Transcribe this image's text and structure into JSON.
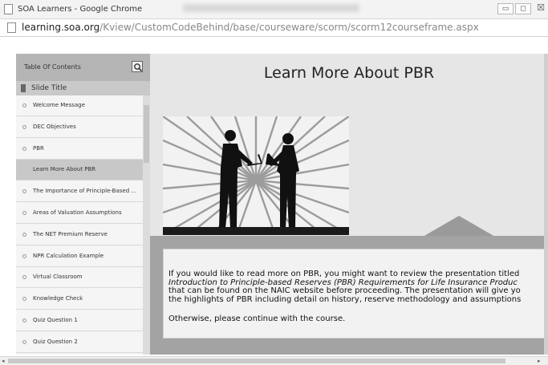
{
  "window": {
    "title": "SOA Learners - Google Chrome",
    "controls": {
      "minimize": "▭",
      "maximize": "◻",
      "close": "☒"
    }
  },
  "address": {
    "host": "learning.soa.org",
    "path": "/Kview/CustomCodeBehind/base/courseware/scorm/scorm12courseframe.aspx"
  },
  "toc": {
    "title": "Table Of Contents",
    "column_header": "Slide Title",
    "items": [
      {
        "label": "Welcome Message",
        "active": false
      },
      {
        "label": "DEC Objectives",
        "active": false
      },
      {
        "label": "PBR",
        "active": false
      },
      {
        "label": "Learn More About PBR",
        "active": true
      },
      {
        "label": "The Importance of Principle-Based ...",
        "active": false
      },
      {
        "label": "Areas of Valuation Assumptions",
        "active": false
      },
      {
        "label": "The NET Premium Reserve",
        "active": false
      },
      {
        "label": "NPR Calculation Example",
        "active": false
      },
      {
        "label": "Virtual Classroom",
        "active": false
      },
      {
        "label": "Knowledge Check",
        "active": false
      },
      {
        "label": "Quiz Question 1",
        "active": false
      },
      {
        "label": "Quiz Question 2",
        "active": false
      }
    ]
  },
  "slide": {
    "title": "Learn More About PBR",
    "paragraph1": {
      "line1": "If you would like to read more on PBR, you might want to review the presentation titled",
      "line2_italic": "Introduction to Principle-based Reserves (PBR) Requirements for Life Insurance Produc",
      "line3": "that can be found on the NAIC website before proceeding. The presentation will give yo",
      "line4": "the highlights of PBR including detail on history, reserve methodology and assumptions"
    },
    "paragraph2": "Otherwise, please continue with the course."
  },
  "icons": {
    "search": "search-icon",
    "bookmark": "bookmark-icon",
    "page": "page-icon"
  },
  "colors": {
    "sidebar_header": "#b5b5b5",
    "active_item": "#c8c8c8",
    "content_bg": "#e6e6e6",
    "band": "#a3a3a3"
  }
}
